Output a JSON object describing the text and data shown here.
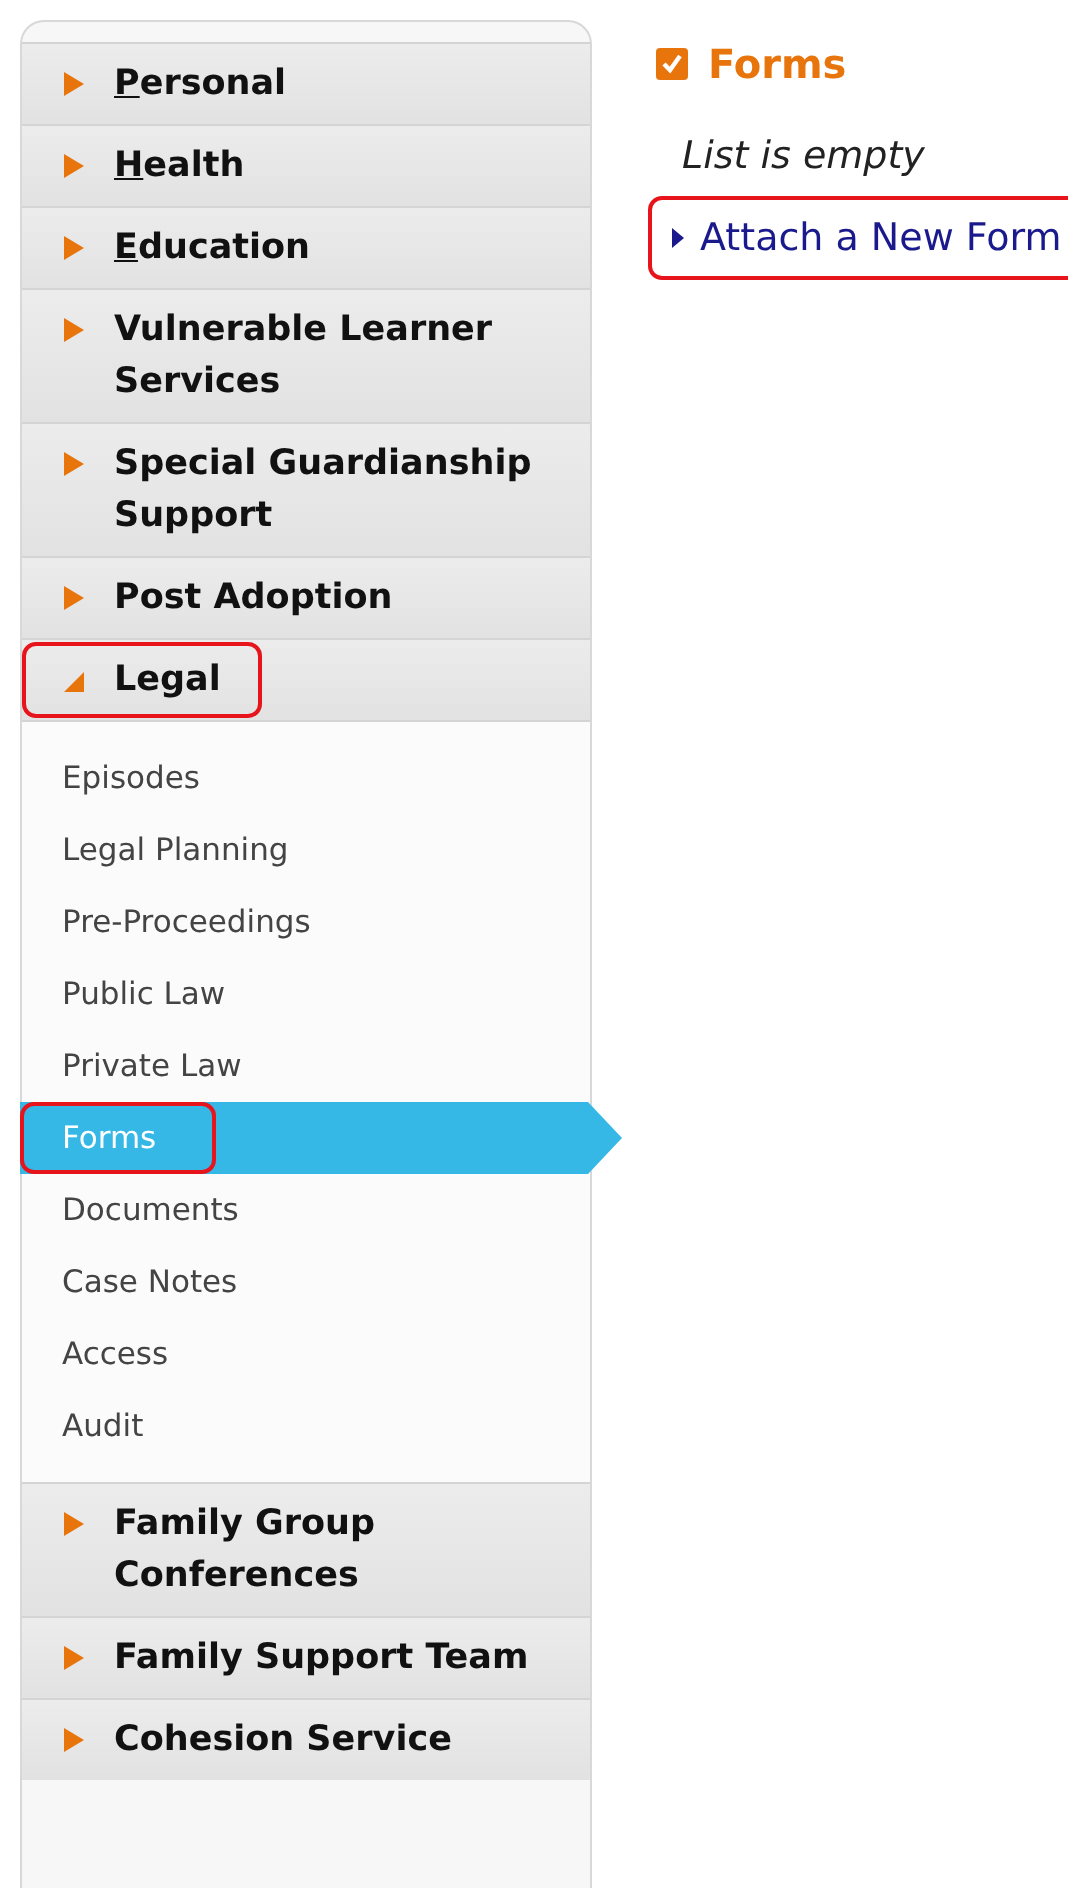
{
  "sidebar": {
    "sections": [
      {
        "label": "Personal",
        "expanded": false,
        "accesskey_underlined": true,
        "highlighted": false
      },
      {
        "label": "Health",
        "expanded": false,
        "accesskey_underlined": true,
        "highlighted": false
      },
      {
        "label": "Education",
        "expanded": false,
        "accesskey_underlined": true,
        "highlighted": false
      },
      {
        "label": "Vulnerable Learner Services",
        "expanded": false,
        "accesskey_underlined": false,
        "highlighted": false
      },
      {
        "label": "Special Guardianship Support",
        "expanded": false,
        "accesskey_underlined": false,
        "highlighted": false
      },
      {
        "label": "Post Adoption",
        "expanded": false,
        "accesskey_underlined": false,
        "highlighted": false
      },
      {
        "label": "Legal",
        "expanded": true,
        "accesskey_underlined": false,
        "highlighted": true,
        "children": [
          {
            "label": "Episodes",
            "selected": false,
            "highlighted": false
          },
          {
            "label": "Legal Planning",
            "selected": false,
            "highlighted": false
          },
          {
            "label": "Pre-Proceedings",
            "selected": false,
            "highlighted": false
          },
          {
            "label": "Public Law",
            "selected": false,
            "highlighted": false
          },
          {
            "label": "Private Law",
            "selected": false,
            "highlighted": false
          },
          {
            "label": "Forms",
            "selected": true,
            "highlighted": true
          },
          {
            "label": "Documents",
            "selected": false,
            "highlighted": false
          },
          {
            "label": "Case Notes",
            "selected": false,
            "highlighted": false
          },
          {
            "label": "Access",
            "selected": false,
            "highlighted": false
          },
          {
            "label": "Audit",
            "selected": false,
            "highlighted": false
          }
        ]
      },
      {
        "label": "Family Group Conferences",
        "expanded": false,
        "accesskey_underlined": false,
        "highlighted": false
      },
      {
        "label": "Family Support Team",
        "expanded": false,
        "accesskey_underlined": false,
        "highlighted": false
      },
      {
        "label": "Cohesion Service",
        "expanded": false,
        "accesskey_underlined": false,
        "highlighted": false
      }
    ]
  },
  "content": {
    "title": "Forms",
    "empty_message": "List is empty",
    "link": {
      "label": "Attach a New Form",
      "highlighted": true
    }
  }
}
